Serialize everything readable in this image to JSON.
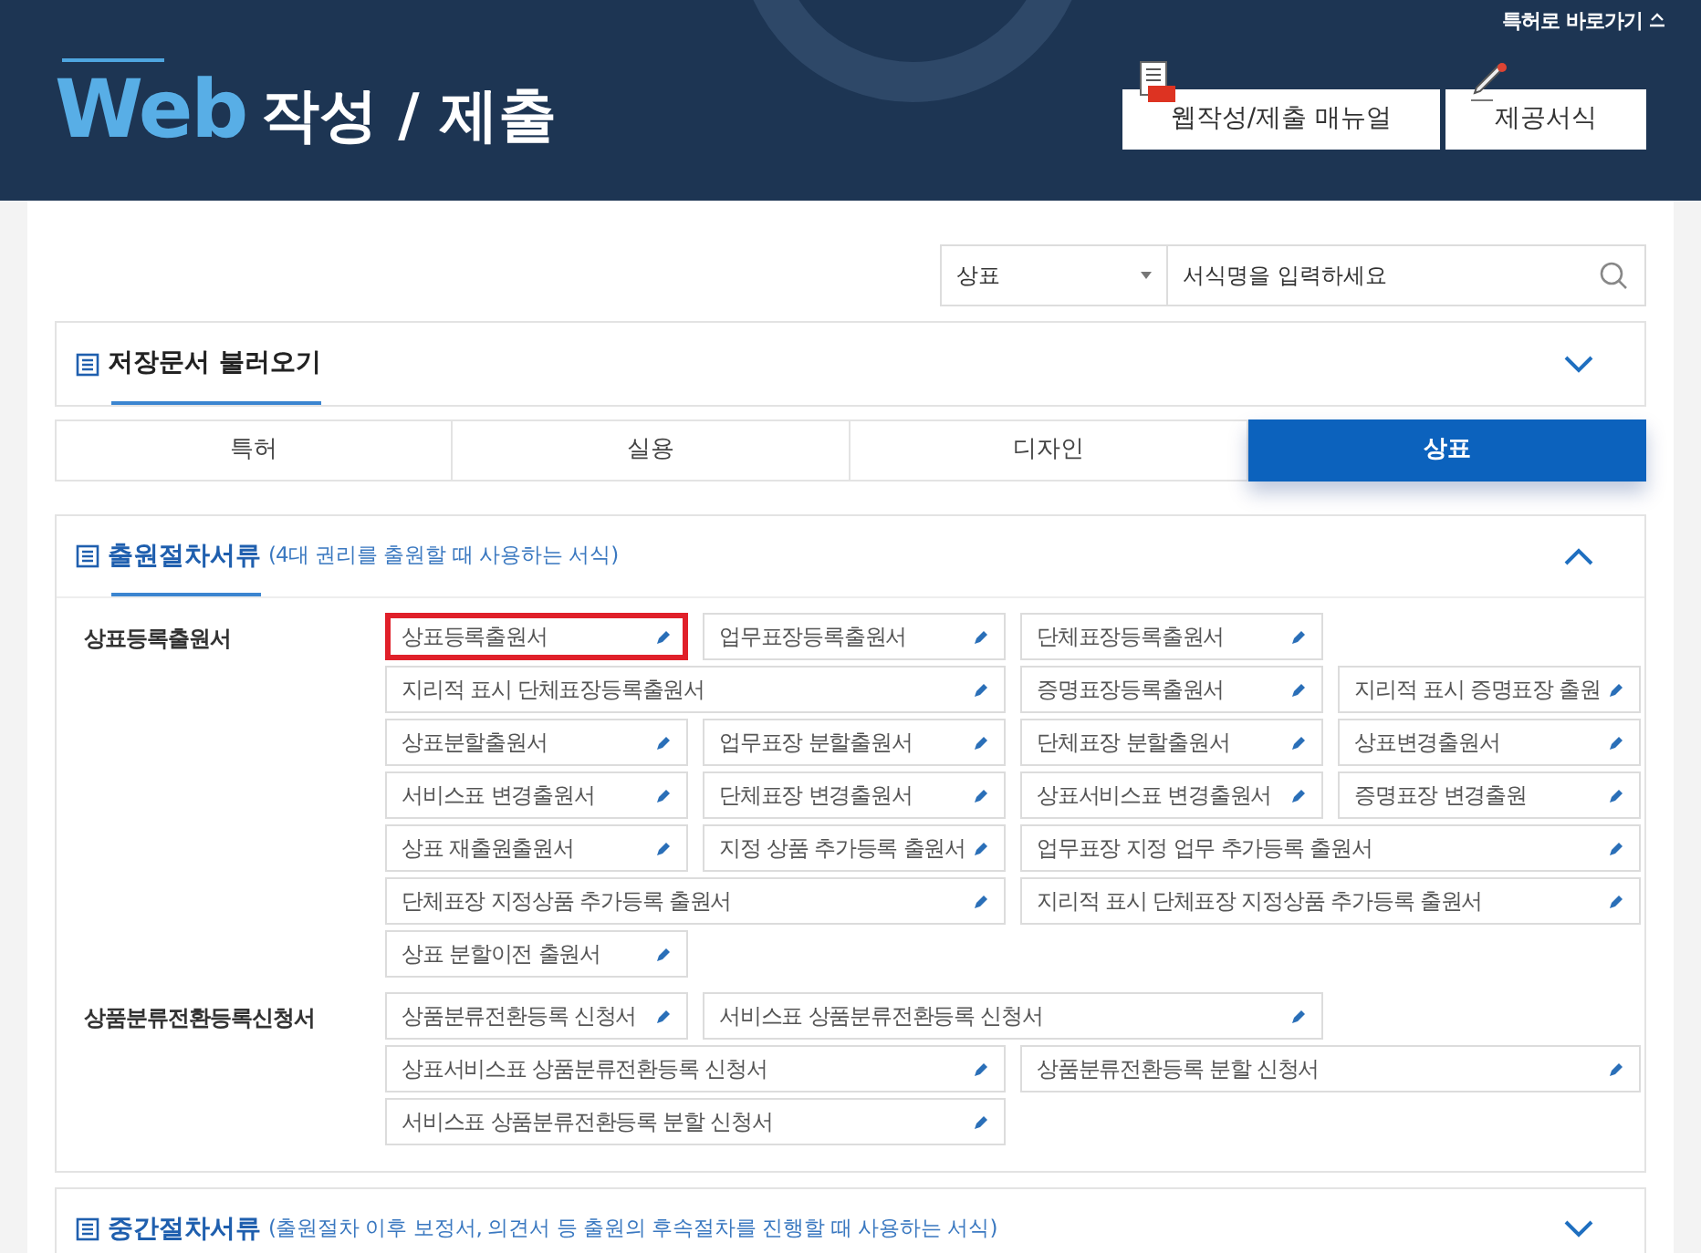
{
  "header": {
    "shortcut": "특허로 바로가기",
    "logo_word": "Web",
    "title": "작성 / 제출",
    "buttons": [
      {
        "kind": "manual",
        "label": "웹작성/제출 매뉴얼"
      },
      {
        "kind": "forms",
        "label": "제공서식"
      }
    ]
  },
  "search": {
    "category": "상표",
    "placeholder": "서식명을 입력하세요"
  },
  "saved_docs": {
    "title": "저장문서 불러오기",
    "expanded": false
  },
  "tabs": [
    {
      "label": "특허",
      "selected": false
    },
    {
      "label": "실용",
      "selected": false
    },
    {
      "label": "디자인",
      "selected": false
    },
    {
      "label": "상표",
      "selected": true
    }
  ],
  "sections": [
    {
      "title": "출원절차서류",
      "note": "(4대 권리를 출원할 때 사용하는 서식)",
      "expanded": true,
      "groups": [
        {
          "label": "상표등록출원서",
          "forms": [
            {
              "name": "상표등록출원서",
              "kind": "normal",
              "selected": true
            },
            {
              "name": "업무표장등록출원서",
              "kind": "normal",
              "selected": false
            },
            {
              "name": "단체표장등록출원서",
              "kind": "normal",
              "selected": false
            },
            {
              "name": "지리적 표시 단체표장등록출원서",
              "kind": "wide",
              "selected": false
            },
            {
              "name": "증명표장등록출원서",
              "kind": "normal",
              "selected": false
            },
            {
              "name": "지리적 표시 증명표장 출원",
              "kind": "normal",
              "selected": false
            },
            {
              "name": "상표분할출원서",
              "kind": "normal",
              "selected": false
            },
            {
              "name": "업무표장 분할출원서",
              "kind": "normal",
              "selected": false
            },
            {
              "name": "단체표장 분할출원서",
              "kind": "normal",
              "selected": false
            },
            {
              "name": "상표변경출원서",
              "kind": "normal",
              "selected": false
            },
            {
              "name": "서비스표 변경출원서",
              "kind": "normal",
              "selected": false
            },
            {
              "name": "단체표장 변경출원서",
              "kind": "normal",
              "selected": false
            },
            {
              "name": "상표서비스표 변경출원서",
              "kind": "normal",
              "selected": false
            },
            {
              "name": "증명표장 변경출원",
              "kind": "normal",
              "selected": false
            },
            {
              "name": "상표 재출원출원서",
              "kind": "normal",
              "selected": false
            },
            {
              "name": "지정 상품 추가등록 출원서",
              "kind": "normal",
              "selected": false
            },
            {
              "name": "업무표장 지정 업무 추가등록 출원서",
              "kind": "wide",
              "selected": false
            },
            {
              "name": "단체표장 지정상품 추가등록 출원서",
              "kind": "wide",
              "selected": false
            },
            {
              "name": "지리적 표시 단체표장 지정상품 추가등록 출원서",
              "kind": "wide",
              "selected": false
            },
            {
              "name": "상표 분할이전 출원서",
              "kind": "normal",
              "selected": false
            }
          ]
        },
        {
          "label": "상품분류전환등록신청서",
          "forms": [
            {
              "name": "상품분류전환등록 신청서",
              "kind": "normal",
              "selected": false
            },
            {
              "name": "서비스표 상품분류전환등록 신청서",
              "kind": "wide",
              "selected": false
            },
            {
              "name": "상표서비스표 상품분류전환등록 신청서",
              "kind": "wide",
              "selected": false
            },
            {
              "name": "상품분류전환등록 분할 신청서",
              "kind": "wide",
              "selected": false
            },
            {
              "name": "서비스표 상품분류전환등록 분할 신청서",
              "kind": "wide",
              "selected": false
            }
          ]
        }
      ]
    },
    {
      "title": "중간절차서류",
      "note": "(출원절차 이후 보정서, 의견서 등 출원의 후속절차를 진행할 때 사용하는 서식)",
      "expanded": false
    }
  ]
}
